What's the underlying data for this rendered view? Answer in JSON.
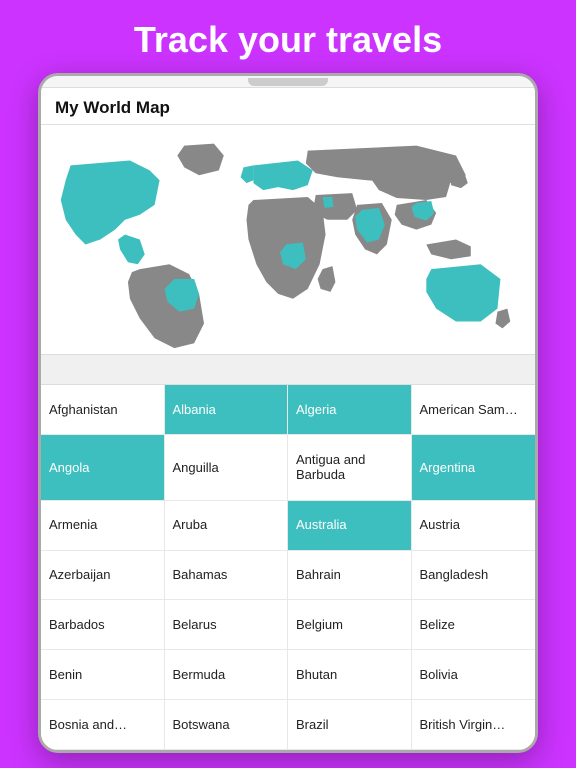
{
  "header": {
    "title": "Track your travels"
  },
  "app": {
    "map_title": "My World Map"
  },
  "countries": [
    {
      "name": "Afghanistan",
      "visited": false
    },
    {
      "name": "Albania",
      "visited": true
    },
    {
      "name": "Algeria",
      "visited": true
    },
    {
      "name": "American Sam…",
      "visited": false
    },
    {
      "name": "Angola",
      "visited": true
    },
    {
      "name": "Anguilla",
      "visited": false
    },
    {
      "name": "Antigua and Barbuda",
      "visited": false
    },
    {
      "name": "Argentina",
      "visited": true
    },
    {
      "name": "Armenia",
      "visited": false
    },
    {
      "name": "Aruba",
      "visited": false
    },
    {
      "name": "Australia",
      "visited": true
    },
    {
      "name": "Austria",
      "visited": false
    },
    {
      "name": "Azerbaijan",
      "visited": false
    },
    {
      "name": "Bahamas",
      "visited": false
    },
    {
      "name": "Bahrain",
      "visited": false
    },
    {
      "name": "Bangladesh",
      "visited": false
    },
    {
      "name": "Barbados",
      "visited": false
    },
    {
      "name": "Belarus",
      "visited": false
    },
    {
      "name": "Belgium",
      "visited": false
    },
    {
      "name": "Belize",
      "visited": false
    },
    {
      "name": "Benin",
      "visited": false
    },
    {
      "name": "Bermuda",
      "visited": false
    },
    {
      "name": "Bhutan",
      "visited": false
    },
    {
      "name": "Bolivia",
      "visited": false
    },
    {
      "name": "Bosnia and…",
      "visited": false
    },
    {
      "name": "Botswana",
      "visited": false
    },
    {
      "name": "Brazil",
      "visited": false
    },
    {
      "name": "British Virgin…",
      "visited": false
    }
  ]
}
